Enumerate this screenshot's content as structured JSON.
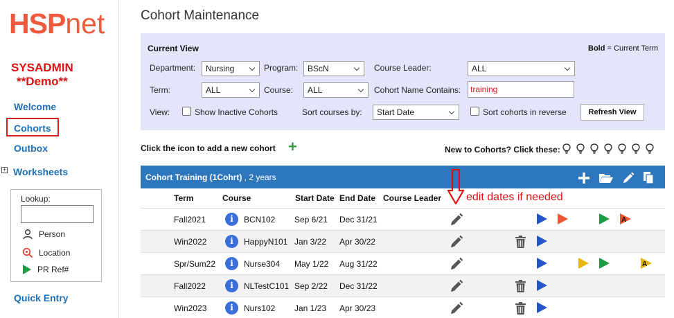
{
  "sidebar": {
    "logo_main": "HSP",
    "logo_net": "net",
    "user_line1": "SYSADMIN",
    "user_line2": "**Demo**",
    "nav": {
      "welcome": "Welcome",
      "cohorts": "Cohorts",
      "outbox": "Outbox",
      "worksheets": "Worksheets",
      "quick_entry": "Quick Entry"
    },
    "worksheets_expander": "+",
    "lookup": {
      "title": "Lookup:",
      "input_value": "",
      "person": "Person",
      "location": "Location",
      "pr_ref": "PR Ref#"
    }
  },
  "page_title": "Cohort Maintenance",
  "filters": {
    "heading": "Current View",
    "note_bold": "Bold",
    "note_rest": " = Current Term",
    "department_label": "Department:",
    "department_value": "Nursing",
    "program_label": "Program:",
    "program_value": "BScN",
    "course_leader_label": "Course Leader:",
    "course_leader_value": "ALL",
    "term_label": "Term:",
    "term_value": "ALL",
    "course_label": "Course:",
    "course_value": "ALL",
    "name_contains_label": "Cohort Name Contains:",
    "name_contains_value": "training",
    "view_label": "View:",
    "show_inactive_label": "Show Inactive Cohorts",
    "show_inactive_checked": false,
    "sort_by_label": "Sort courses by:",
    "sort_by_value": "Start Date",
    "sort_reverse_label": "Sort cohorts in reverse",
    "sort_reverse_checked": false,
    "refresh_button": "Refresh View"
  },
  "add_cohort_text": "Click the icon to add a new cohort",
  "add_cohort_icon": "plus-icon",
  "new_to_cohorts_text": "New to Cohorts? Click these:",
  "help_bulbs": 7,
  "cohort": {
    "title_bold": "Cohort Training (1Cohrt)",
    "title_rest": " , 2 years",
    "actions": [
      "plus-icon",
      "folder-open-icon",
      "pencil-icon",
      "copy-icon"
    ]
  },
  "table": {
    "headers": {
      "term": "Term",
      "course": "Course",
      "start": "Start Date",
      "end": "End Date",
      "leader": "Course Leader"
    },
    "rows": [
      {
        "term": "Fall2021",
        "course": "BCN102",
        "start": "Sep 6/21",
        "end": "Dec 31/21"
      },
      {
        "term": "Win2022",
        "course": "HappyN101",
        "start": "Jan 3/22",
        "end": "Apr 30/22"
      },
      {
        "term": "Spr/Sum22",
        "course": "Nurse304",
        "start": "May 1/22",
        "end": "Aug 31/22"
      },
      {
        "term": "Fall2022",
        "course": "NLTestC101",
        "start": "Sep 2/22",
        "end": "Dec 31/22"
      },
      {
        "term": "Win2023",
        "course": "Nurs102",
        "start": "Jan 1/23",
        "end": "Apr 30/23"
      }
    ]
  },
  "annotation": "edit dates if needed",
  "colors": {
    "accent": "#2f77bc",
    "logo": "#ef5a3d",
    "alert": "#e01010",
    "link": "#1e6fb5",
    "panel": "#e3e6fb",
    "play_blue": "#2456c9",
    "play_red": "#ee5533",
    "play_green": "#1f9a45",
    "play_yellow": "#e8b800"
  }
}
